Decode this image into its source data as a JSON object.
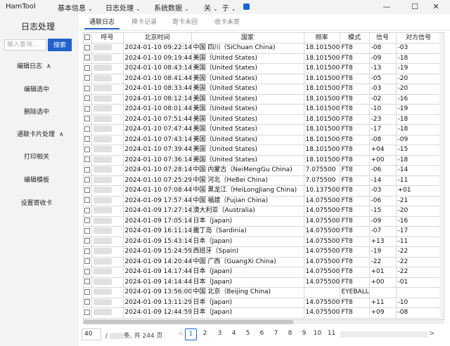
{
  "app_title": "HamTool",
  "menus": [
    "基本信息",
    "日志处理",
    "系统数据",
    "关",
    "于"
  ],
  "window_controls": {
    "minimize": "—",
    "maximize": "☐",
    "close": "✕"
  },
  "sidebar": {
    "title": "日志处理",
    "search_placeholder": "输入查询...",
    "search_button": "搜索",
    "group1": "编辑日志",
    "items1": [
      "编辑选中",
      "删除选中"
    ],
    "group2": "通联卡片处理",
    "items2": [
      "打印相关",
      "编辑模板",
      "设置寄收卡"
    ]
  },
  "tabs": [
    "通联日志",
    "换卡记录",
    "寄卡未回",
    "收卡未寄"
  ],
  "table": {
    "headers": [
      "",
      "呼号",
      "北京时间",
      "国家",
      "频率",
      "模式",
      "信号",
      "对方信号"
    ],
    "rows": [
      [
        "2024-01-10 09:22:14",
        "中国 四川（SiChuan China)",
        "18.101500",
        "FT8",
        "-08",
        "-03"
      ],
      [
        "2024-01-10 09:19:44",
        "美国（United States)",
        "18.101500",
        "FT8",
        "-09",
        "-18"
      ],
      [
        "2024-01-10 08:43:14",
        "美国（United States)",
        "18.101500",
        "FT8",
        "-13",
        "-19"
      ],
      [
        "2024-01-10 08:41:44",
        "美国（United States)",
        "18.101500",
        "FT8",
        "-05",
        "-20"
      ],
      [
        "2024-01-10 08:33:44",
        "美国（United States)",
        "18.101500",
        "FT8",
        "-03",
        "-20"
      ],
      [
        "2024-01-10 08:12:14",
        "美国（United States)",
        "18.101500",
        "FT8",
        "-02",
        "-16"
      ],
      [
        "2024-01-10 08:01:44",
        "美国（United States)",
        "18.101500",
        "FT8",
        "-10",
        "-19"
      ],
      [
        "2024-01-10 07:51:44",
        "美国（United States)",
        "18.101500",
        "FT8",
        "-23",
        "-18"
      ],
      [
        "2024-01-10 07:47:44",
        "美国（United States)",
        "18.101500",
        "FT8",
        "-17",
        "-18"
      ],
      [
        "2024-01-10 07:43:14",
        "美国（United States)",
        "18.101500",
        "FT8",
        "-08",
        "-09"
      ],
      [
        "2024-01-10 07:39:44",
        "美国（United States)",
        "18.101500",
        "FT8",
        "+04",
        "-15"
      ],
      [
        "2024-01-10 07:36:14",
        "美国（United States)",
        "18.101500",
        "FT8",
        "+00",
        "-18"
      ],
      [
        "2024-01-10 07:28:14",
        "中国 内蒙古（NeiMengGu China)",
        "7.075500",
        "FT8",
        "-06",
        "-14"
      ],
      [
        "2024-01-10 07:25:29",
        "中国 河北（HeBei China)",
        "7.075500",
        "FT8",
        "-14",
        "-11"
      ],
      [
        "2024-01-10 07:08:44",
        "中国 黑龙江（HeiLongJiang China)",
        "10.137500",
        "FT8",
        "-03",
        "+01"
      ],
      [
        "2024-01-09 17:57:44",
        "中国 福建（Fujian China)",
        "14.075500",
        "FT8",
        "-06",
        "-21"
      ],
      [
        "2024-01-09 17:27:14",
        "澳大利亚（Australia)",
        "14.075500",
        "FT8",
        "-15",
        "-20"
      ],
      [
        "2024-01-09 17:05:14",
        "日本（Japan)",
        "14.075500",
        "FT8",
        "-09",
        "-16"
      ],
      [
        "2024-01-09 16:11:14",
        "撒丁岛（Sardinia)",
        "14.075500",
        "FT8",
        "-07",
        "-17"
      ],
      [
        "2024-01-09 15:43:14",
        "日本（Japan)",
        "14.075500",
        "FT8",
        "+13",
        "-11"
      ],
      [
        "2024-01-09 15:24:59",
        "西班牙（Spain)",
        "14.075500",
        "FT8",
        "-19",
        "-22"
      ],
      [
        "2024-01-09 14:20:44",
        "中国 广西（GuangXi China)",
        "14.075500",
        "FT8",
        "-22",
        "-22"
      ],
      [
        "2024-01-09 14:17:44",
        "日本（Japan)",
        "14.075500",
        "FT8",
        "+01",
        "-22"
      ],
      [
        "2024-01-09 14:14:44",
        "日本（Japan)",
        "14.075500",
        "FT8",
        "+00",
        "-01"
      ],
      [
        "2024-01-09 13:56:00",
        "中国 北京（Beijing China)",
        "",
        "EYEBALL",
        "",
        ""
      ],
      [
        "2024-01-09 13:11:29",
        "日本（Japan)",
        "14.075500",
        "FT8",
        "+11",
        "-10"
      ],
      [
        "2024-01-09 12:44:59",
        "日本（Japan)",
        "14.075500",
        "FT8",
        "+09",
        "-08"
      ]
    ]
  },
  "pager": {
    "page_size": "40",
    "total_prefix": "/ ",
    "total_suffix": "条, 共 244 页",
    "prev": "<",
    "next": ">",
    "pages": [
      "1",
      "2",
      "3",
      "4",
      "5",
      "6",
      "7",
      "8",
      "9",
      "10",
      "11"
    ],
    "current": "1"
  },
  "colors": {
    "accent": "#1f62cc"
  }
}
